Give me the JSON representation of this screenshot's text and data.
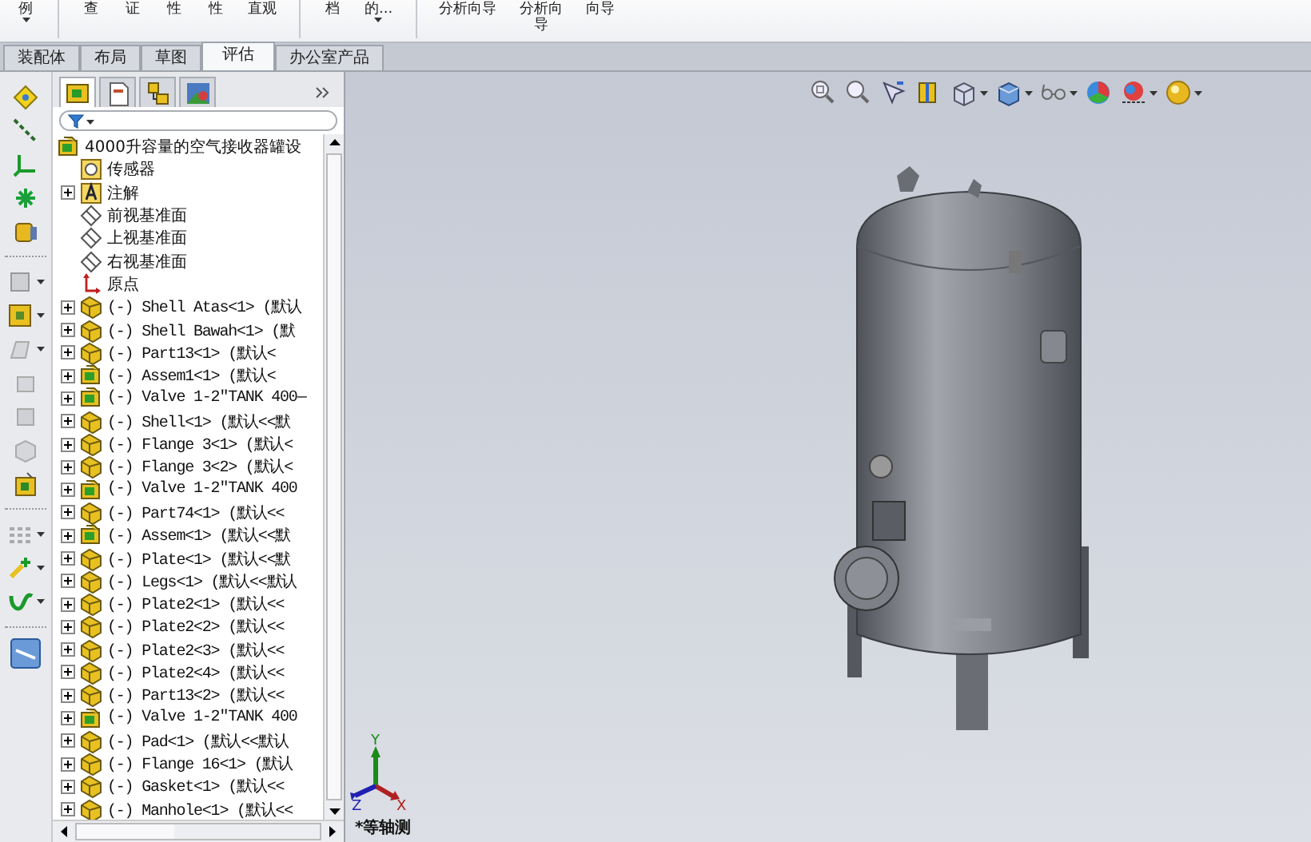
{
  "ribbon": [
    {
      "label": "例",
      "dropdown": true
    },
    {
      "label": "查",
      "dropdown": false
    },
    {
      "label": "证",
      "dropdown": false
    },
    {
      "label": "性",
      "dropdown": false
    },
    {
      "label": "性",
      "dropdown": false
    },
    {
      "label": "直观",
      "dropdown": false
    },
    {
      "label": "档",
      "dropdown": false
    },
    {
      "label": "的...",
      "dropdown": true
    },
    {
      "label": "分析向导",
      "dropdown": false
    },
    {
      "label": "分析向导",
      "dropdown": false,
      "wrapped": true
    },
    {
      "label": "向导",
      "dropdown": false
    }
  ],
  "tabs": [
    {
      "label": "装配体",
      "selected": false
    },
    {
      "label": "布局",
      "selected": false
    },
    {
      "label": "草图",
      "selected": false
    },
    {
      "label": "评估",
      "selected": true
    },
    {
      "label": "办公室产品",
      "selected": false
    }
  ],
  "panel_tabs": [
    {
      "selected": true
    },
    {
      "selected": false
    },
    {
      "selected": false
    },
    {
      "selected": false
    }
  ],
  "tree": {
    "label": "4000升容量的空气接收器罐设",
    "kind": "assembly",
    "children": [
      {
        "label": "传感器",
        "kind": "sensor"
      },
      {
        "label": "注解",
        "kind": "annotation",
        "expanded": false
      },
      {
        "label": "前视基准面",
        "kind": "plane"
      },
      {
        "label": "上视基准面",
        "kind": "plane"
      },
      {
        "label": "右视基准面",
        "kind": "plane"
      },
      {
        "label": "原点",
        "kind": "origin"
      },
      {
        "label": "(-) Shell Atas<1> (默认",
        "kind": "part",
        "expanded": false
      },
      {
        "label": "(-) Shell Bawah<1> (默",
        "kind": "part",
        "expanded": false
      },
      {
        "label": "(-) Part13<1> (默认<",
        "kind": "part",
        "expanded": false
      },
      {
        "label": "(-) Assem1<1> (默认<",
        "kind": "assembly",
        "expanded": false
      },
      {
        "label": "(-) Valve 1-2\"TANK 400—",
        "kind": "assembly",
        "expanded": false
      },
      {
        "label": "(-) Shell<1> (默认<<默",
        "kind": "part",
        "expanded": false
      },
      {
        "label": "(-) Flange 3<1> (默认<",
        "kind": "part",
        "expanded": false
      },
      {
        "label": "(-) Flange 3<2> (默认<",
        "kind": "part",
        "expanded": false
      },
      {
        "label": "(-) Valve 1-2\"TANK 400",
        "kind": "assembly",
        "expanded": false
      },
      {
        "label": "(-) Part74<1> (默认<<",
        "kind": "part",
        "expanded": false
      },
      {
        "label": "(-) Assem<1> (默认<<默",
        "kind": "assembly",
        "expanded": false
      },
      {
        "label": "(-) Plate<1> (默认<<默",
        "kind": "part",
        "expanded": false
      },
      {
        "label": "(-) Legs<1> (默认<<默认",
        "kind": "part",
        "expanded": false
      },
      {
        "label": "(-) Plate2<1> (默认<<",
        "kind": "part",
        "expanded": false
      },
      {
        "label": "(-) Plate2<2> (默认<<",
        "kind": "part",
        "expanded": false
      },
      {
        "label": "(-) Plate2<3> (默认<<",
        "kind": "part",
        "expanded": false
      },
      {
        "label": "(-) Plate2<4> (默认<<",
        "kind": "part",
        "expanded": false
      },
      {
        "label": "(-) Part13<2> (默认<<",
        "kind": "part",
        "expanded": false
      },
      {
        "label": "(-) Valve 1-2\"TANK 400",
        "kind": "assembly",
        "expanded": false
      },
      {
        "label": "(-) Pad<1> (默认<<默认",
        "kind": "part",
        "expanded": false
      },
      {
        "label": "(-) Flange 16<1> (默认",
        "kind": "part",
        "expanded": false
      },
      {
        "label": "(-) Gasket<1> (默认<<",
        "kind": "part",
        "expanded": false
      },
      {
        "label": "(-) Manhole<1> (默认<<",
        "kind": "part",
        "expanded": false
      }
    ]
  },
  "viewport": {
    "axes": [
      "Y",
      "Z",
      "X"
    ],
    "view_name": "*等轴测"
  }
}
